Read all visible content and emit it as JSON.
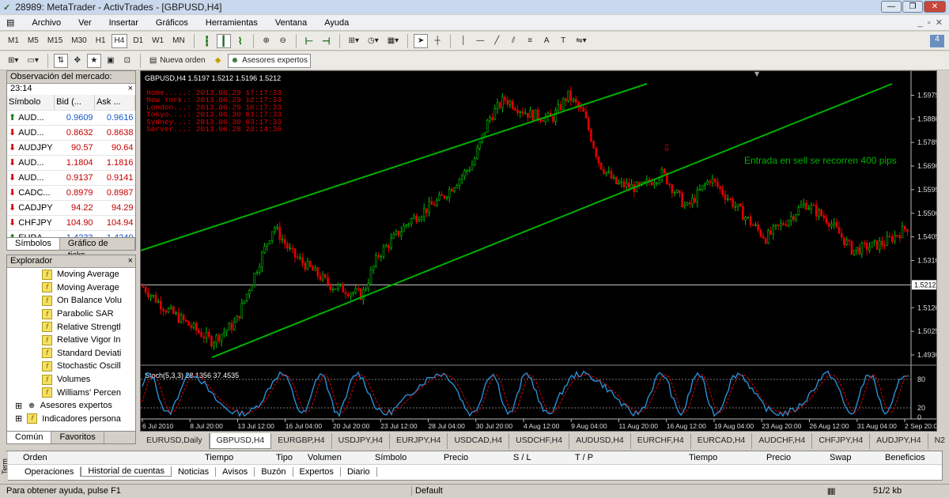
{
  "window": {
    "title": "28989: MetaTrader - ActivTrades - [GBPUSD,H4]"
  },
  "menu": [
    "Archivo",
    "Ver",
    "Insertar",
    "Gráficos",
    "Herramientas",
    "Ventana",
    "Ayuda"
  ],
  "timeframes": [
    "M1",
    "M5",
    "M15",
    "M30",
    "H1",
    "H4",
    "D1",
    "W1",
    "MN"
  ],
  "selected_timeframe": "H4",
  "toolbar2": {
    "new_order": "Nueva orden",
    "experts": "Asesores expertos"
  },
  "market_watch": {
    "title": "Observación del mercado: 23:14",
    "headers": [
      "Símbolo",
      "Bid (...",
      "Ask ..."
    ],
    "rows": [
      {
        "symbol": "AUD...",
        "bid": "0.9609",
        "ask": "0.9616",
        "dir": "up",
        "color": "blue"
      },
      {
        "symbol": "AUD...",
        "bid": "0.8632",
        "ask": "0.8638",
        "dir": "down",
        "color": "red"
      },
      {
        "symbol": "AUDJPY",
        "bid": "90.57",
        "ask": "90.64",
        "dir": "down",
        "color": "red"
      },
      {
        "symbol": "AUD...",
        "bid": "1.1804",
        "ask": "1.1816",
        "dir": "down",
        "color": "red"
      },
      {
        "symbol": "AUD...",
        "bid": "0.9137",
        "ask": "0.9141",
        "dir": "down",
        "color": "red"
      },
      {
        "symbol": "CADC...",
        "bid": "0.8979",
        "ask": "0.8987",
        "dir": "down",
        "color": "red"
      },
      {
        "symbol": "CADJPY",
        "bid": "94.22",
        "ask": "94.29",
        "dir": "down",
        "color": "red"
      },
      {
        "symbol": "CHFJPY",
        "bid": "104.90",
        "ask": "104.94",
        "dir": "down",
        "color": "red"
      },
      {
        "symbol": "EURA...",
        "bid": "1.4233",
        "ask": "1.4240",
        "dir": "up",
        "color": "blue"
      }
    ],
    "tabs": [
      "Símbolos",
      "Gráfico de ticks"
    ]
  },
  "navigator": {
    "title": "Explorador",
    "items": [
      "Moving Average",
      "Moving Average",
      "On Balance Volu",
      "Parabolic SAR",
      "Relative Strengtl",
      "Relative Vigor In",
      "Standard Deviati",
      "Stochastic Oscill",
      "Volumes",
      "Williams' Percen"
    ],
    "folders": [
      "Asesores expertos",
      "Indicadores persona"
    ],
    "tabs": [
      "Común",
      "Favoritos"
    ]
  },
  "chart": {
    "header": "GBPUSD,H4  1.5197 1.5212 1.5196 1.5212",
    "times": [
      "Home.....: 2013.06.29 17:17:33",
      "New York.: 2013.06.29 12:17:33",
      "London...: 2013.06.29 16:17:33",
      "Tokyo....: 2013.06.30 01:17:33",
      "Sydney...: 2013.06.30 03:17:33",
      "Server...: 2013.06.28 23:14:36"
    ],
    "annotation": "Entrada en sell se recorren 400 pips",
    "current_price": "1.5212",
    "price_ticks": [
      "1.5975",
      "1.5880",
      "1.5785",
      "1.5690",
      "1.5595",
      "1.5500",
      "1.5405",
      "1.5310",
      "1.5120",
      "1.5025",
      "1.4930"
    ],
    "stoch_label": "Stoch(5,3,3) 28.1356 37.4535",
    "stoch_ticks": [
      "80",
      "20",
      "0"
    ],
    "date_ticks": [
      "6 Jul 2010",
      "8 Jul 20:00",
      "13 Jul 12:00",
      "16 Jul 04:00",
      "20 Jul 20:00",
      "23 Jul 12:00",
      "28 Jul 04:00",
      "30 Jul 20:00",
      "4 Aug 12:00",
      "9 Aug 04:00",
      "11 Aug 20:00",
      "16 Aug 12:00",
      "19 Aug 04:00",
      "23 Aug 20:00",
      "26 Aug 12:00",
      "31 Aug 04:00",
      "2 Sep 20:00"
    ],
    "colors": {
      "bull": "#00c000",
      "bear": "#e00000",
      "channel": "#00b000",
      "stoch_main": "#2b8fd6",
      "stoch_signal": "#e00000"
    }
  },
  "chart_tabs": [
    "EURUSD,Daily",
    "GBPUSD,H4",
    "EURGBP,H4",
    "USDJPY,H4",
    "EURJPY,H4",
    "USDCAD,H4",
    "USDCHF,H4",
    "AUDUSD,H4",
    "EURCHF,H4",
    "EURCAD,H4",
    "AUDCHF,H4",
    "CHFJPY,H4",
    "AUDJPY,H4",
    "N2"
  ],
  "terminal": {
    "headers": [
      "Orden",
      "Tiempo",
      "Tipo",
      "Volumen",
      "Símbolo",
      "Precio",
      "S / L",
      "T / P",
      "Tiempo",
      "Precio",
      "Swap",
      "Beneficios"
    ],
    "tabs": [
      "Operaciones",
      "Historial de cuentas",
      "Noticias",
      "Avisos",
      "Buzón",
      "Expertos",
      "Diario"
    ],
    "side_label": "Term"
  },
  "status": {
    "help": "Para obtener ayuda, pulse F1",
    "profile": "Default",
    "traffic": "51/2 kb"
  }
}
